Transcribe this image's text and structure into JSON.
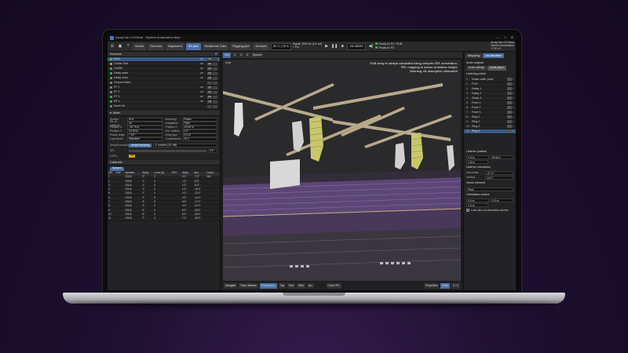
{
  "window": {
    "title": "ArrayCalc V13 Beta - System Auralization.dbpr",
    "controls": [
      "—",
      "□",
      "✕"
    ]
  },
  "toolbar": {
    "tabs": [
      "Venue",
      "Sources",
      "Alignment",
      "3D plot",
      "Headroom Calc",
      "Rigging plot",
      "Devices"
    ],
    "active_tab": "3D plot",
    "temperature": "26 °C | 78 %",
    "signal": "Signal: 4000 Hz (1/1 oct)",
    "signal_sub": "+ Pro",
    "spl_field": "130 dBSPL",
    "status1": "Ready for R1 / SUB",
    "status2": "Ready for R1",
    "right_info1": "ArrayCalc V13 Beta",
    "right_info2": "System Auralization",
    "right_info3": "V 13.0.0"
  },
  "sources": {
    "title": "Sources",
    "items": [
      {
        "name": "Main",
        "color": "#37c24a",
        "a": "AP",
        "b": "ON"
      },
      {
        "name": "Center Sub",
        "color": "#e0a020",
        "a": "AP",
        "b": "ON"
      },
      {
        "name": "OutSB",
        "color": "#37c24a",
        "a": "AP",
        "b": "ON"
      },
      {
        "name": "Delay outer",
        "color": "#37c24a",
        "a": "AP",
        "b": "ON"
      },
      {
        "name": "Delay inner",
        "color": "#37c24a",
        "a": "AP",
        "b": "ON"
      },
      {
        "name": "Ground Subs",
        "color": "#888888",
        "a": "",
        "b": ""
      },
      {
        "name": "FF 1",
        "color": "#888888",
        "a": "AP",
        "b": "ON"
      },
      {
        "name": "FF 2",
        "color": "#888888",
        "a": "AP",
        "b": "ON"
      },
      {
        "name": "FF 3",
        "color": "#37c24a",
        "a": "AP",
        "b": "ON"
      },
      {
        "name": "NF 1",
        "color": "#37c24a",
        "a": "AP",
        "b": "ON"
      },
      {
        "name": "North Ctr",
        "color": "#888888",
        "a": "",
        "b": ""
      }
    ]
  },
  "main_props": {
    "title": "Main",
    "left": [
      {
        "k": "System",
        "v": "SOL"
      },
      {
        "k": "No. of cabinets",
        "v": "16"
      },
      {
        "k": "Position X",
        "v": "-16.75 m"
      },
      {
        "k": "Position Y",
        "v": "19.00 m"
      },
      {
        "k": "Frame angle",
        "v": "7.00 °"
      },
      {
        "k": "Load factor",
        "v": "Standard"
      }
    ],
    "right": [
      {
        "k": "Mounting",
        "v": "Flown"
      },
      {
        "k": "Installation",
        "v": "Flyer"
      },
      {
        "k": "Position Z",
        "v": "14.50 m"
      },
      {
        "k": "Hor. rotation",
        "v": "0.0 °"
      },
      {
        "k": "Array type",
        "v": "0.3 m"
      },
      {
        "k": "Compression",
        "v": "10.1"
      }
    ],
    "processing_label": "ArrayProcessing",
    "processing_value": "ArrayProcessing",
    "processing_mode": "1: concert (XX dB)",
    "spl_label": "SPL",
    "spl_value": "0.0",
    "cplane_label": "CSP's",
    "cplane_value": "Off"
  },
  "cabinets": {
    "title": "Cabinets",
    "tab": "Splayed",
    "headers": [
      "GR",
      "Link",
      "Speaker",
      "Splay",
      "Level (d)",
      "HFC",
      "Splay",
      "Abs.",
      "Comp."
    ],
    "rows": [
      [
        "1",
        "",
        "GSL8",
        "0°",
        "0",
        "",
        "0.0°",
        "-7.0°",
        "N/A"
      ],
      [
        "2",
        "",
        "GSL8",
        "1°",
        "0",
        "",
        "1.0°",
        "-8.0°",
        ""
      ],
      [
        "3",
        "",
        "GSL8",
        "1°",
        "0",
        "",
        "1.0°",
        "-9.0°",
        ""
      ],
      [
        "4",
        "",
        "GSL8",
        "1°",
        "0",
        "",
        "1.0°",
        "-10.0°",
        ""
      ],
      [
        "5",
        "",
        "GSL8",
        "2°",
        "0",
        "",
        "2.0°",
        "-12.0°",
        ""
      ],
      [
        "6",
        "",
        "GSL8",
        "2°",
        "0",
        "",
        "2.0°",
        "-14.0°",
        ""
      ],
      [
        "7",
        "",
        "GSL8",
        "3°",
        "0",
        "",
        "3.0°",
        "-17.0°",
        ""
      ],
      [
        "8",
        "",
        "GSL8",
        "4°",
        "0",
        "",
        "4.0°",
        "-21.0°",
        ""
      ],
      [
        "9",
        "",
        "GSL8",
        "5°",
        "0",
        "",
        "5.0°",
        "-26.0°",
        ""
      ],
      [
        "10",
        "",
        "GSL8",
        "6°",
        "0",
        "",
        "6.0°",
        "-32.0°",
        ""
      ],
      [
        "11",
        "",
        "GSL8",
        "7°",
        "0",
        "",
        "7.0°",
        "-39.0°",
        ""
      ]
    ]
  },
  "viewport": {
    "tabs": [
      "Live",
      "1",
      "2",
      "3",
      "Spaced"
    ],
    "label": "Live",
    "notice1": "SUB array is always calculated using complex SPL summation.",
    "notice2": "SPL mapping is shown at listener height.",
    "notice3": "Warning: Air absorption mismatch!",
    "bottom": [
      "Navigate",
      "Place listener",
      "First person",
      "Top",
      "End",
      "Side",
      "Iso",
      "Clear SPL",
      "Properties",
      "Solid",
      "X / Z"
    ],
    "bottom_active": [
      "First person",
      "Solid"
    ]
  },
  "audio_panel": {
    "tabs": [
      "Mapping",
      "Auralization"
    ],
    "audio_original": "Audio original",
    "audio_settings": "Audio settings",
    "audio_player": "Audio player",
    "listening_title": "Listening points",
    "points": [
      "Noise calib. point",
      "FOH",
      "Delay 1",
      "Delay 2",
      "Delay 3",
      "Front 1",
      "Front 2",
      "Front 3",
      "Ring 1",
      "Ring 2",
      "Ring 3",
      "Ring 4"
    ],
    "listener_pos_title": "Listener position",
    "x_val": "1.0 m",
    "y_val": "54.8 m",
    "z_val": "1.8 m",
    "orient_title": "Listener orientation",
    "hor_label": "Horizontal",
    "hor_val": "-27.4 °",
    "ver_label": "Vertical",
    "ver_val": "14.0 °",
    "venue_title": "Venue element",
    "venue_value": "Pitch",
    "anchor_title": "Orientation anchor",
    "ax": "0.0 m",
    "ay": "0.0 m",
    "az": "1.0 m",
    "lock_label": "Lock view on orientation anchor"
  },
  "colors": {
    "accent": "#4a6fa5",
    "selected": "#3b5a86",
    "ok": "#37c24a",
    "grid_purple": "#a070d0"
  }
}
